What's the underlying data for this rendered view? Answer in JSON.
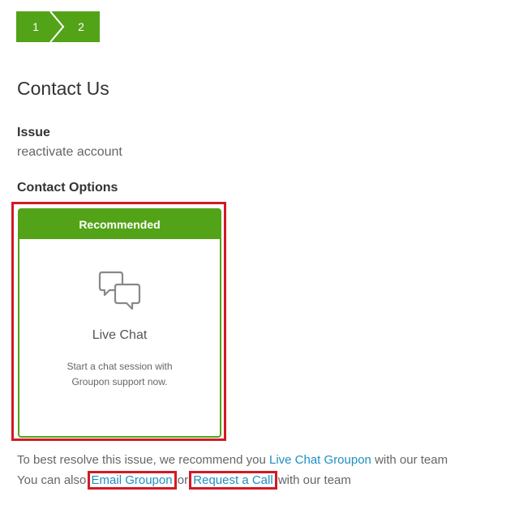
{
  "stepper": {
    "steps": [
      "1",
      "2"
    ],
    "color": "#53a318"
  },
  "page_title": "Contact Us",
  "issue": {
    "heading": "Issue",
    "value": "reactivate account"
  },
  "contact_options": {
    "heading": "Contact Options",
    "card": {
      "banner": "Recommended",
      "icon": "chat-bubbles-icon",
      "title": "Live Chat",
      "description_line1": "Start a chat session with",
      "description_line2": "Groupon support now."
    }
  },
  "footer": {
    "line1_prefix": "To best resolve this issue, we recommend you ",
    "line1_link": "Live Chat Groupon",
    "line1_suffix": " with our team",
    "line2_prefix": "You can also ",
    "email_link": "Email Groupon",
    "line2_middle": " or ",
    "call_link": "Request a Call",
    "line2_suffix": " with our team"
  },
  "colors": {
    "accent_green": "#53a318",
    "link_blue": "#1f8fc2",
    "highlight_red": "#d21a25"
  }
}
